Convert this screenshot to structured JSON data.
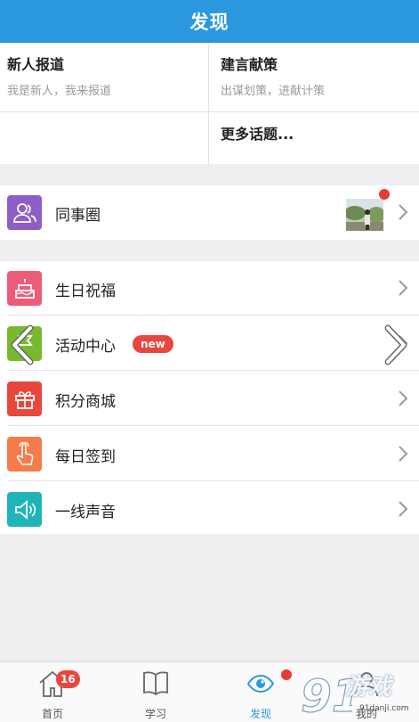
{
  "header": {
    "title": "发现"
  },
  "topics": {
    "newcomer": {
      "title": "新人报道",
      "subtitle": "我是新人，我来报道"
    },
    "advice": {
      "title": "建言献策",
      "subtitle": "出谋划策，进献计策"
    },
    "more": {
      "title": "更多话题..."
    }
  },
  "colleague": {
    "label": "同事圈",
    "icon": "people-icon",
    "icon_color": "#8e5ec7"
  },
  "menu": [
    {
      "label": "生日祝福",
      "icon": "cake-icon",
      "icon_color": "#ec5c78"
    },
    {
      "label": "活动中心",
      "icon": "flag-icon",
      "icon_color": "#79b92d",
      "badge": "new"
    },
    {
      "label": "积分商城",
      "icon": "gift-icon",
      "icon_color": "#e9463d"
    },
    {
      "label": "每日签到",
      "icon": "tap-hand-icon",
      "icon_color": "#f47c4a"
    },
    {
      "label": "一线声音",
      "icon": "speaker-icon",
      "icon_color": "#1fb4b8"
    }
  ],
  "tabbar": {
    "tabs": [
      {
        "label": "首页",
        "icon": "home-icon",
        "badge": "16"
      },
      {
        "label": "学习",
        "icon": "book-icon"
      },
      {
        "label": "发现",
        "icon": "eye-icon",
        "active": true
      },
      {
        "label": "我的",
        "icon": "person-icon"
      }
    ]
  },
  "watermark": {
    "text": "游戏",
    "url": "91danji.com"
  },
  "colors": {
    "accent": "#2b97df",
    "badge_red": "#e9463d"
  }
}
